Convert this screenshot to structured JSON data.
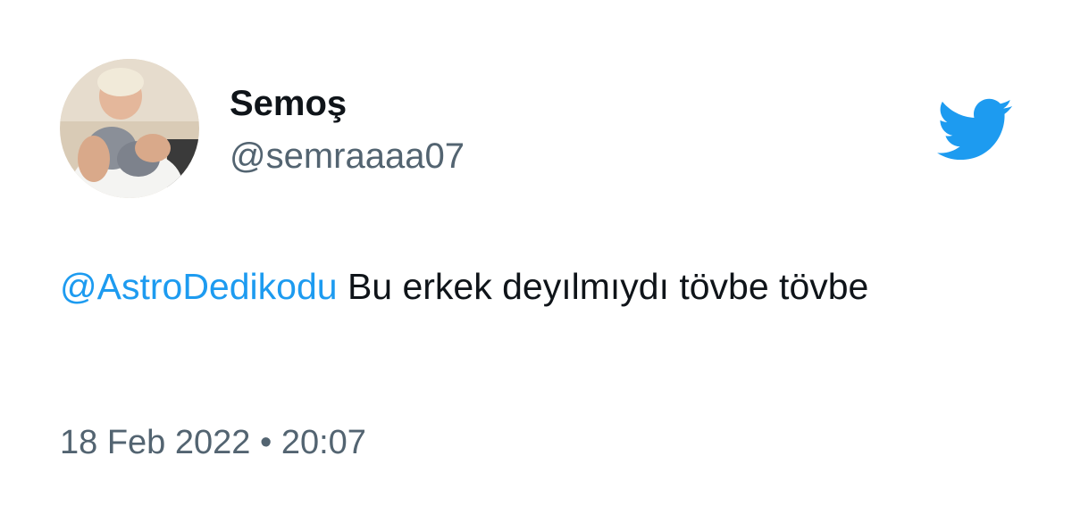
{
  "tweet": {
    "author": {
      "display_name": "Semoş",
      "handle": "@semraaaa07"
    },
    "brand": {
      "icon": "twitter-bird-icon",
      "color": "#1d9bf0"
    },
    "text": {
      "mention": "@AstroDedikodu",
      "body": " Bu erkek deyılmıydı tövbe tövbe"
    },
    "timestamp": "18 Feb 2022 • 20:07"
  },
  "colors": {
    "text": "#0f1419",
    "secondary": "#536471",
    "link": "#1d9bf0",
    "background": "#ffffff"
  }
}
